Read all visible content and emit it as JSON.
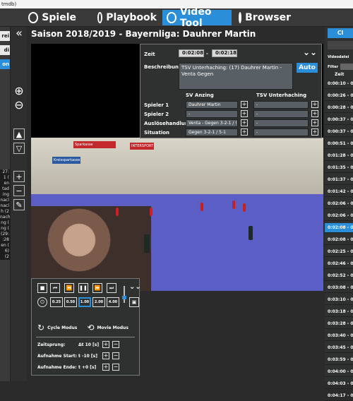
{
  "window_title": "tmdb)",
  "nav": {
    "tabs": [
      {
        "label": "Spiele",
        "icon": "soccer-ball-icon"
      },
      {
        "label": "Playbook",
        "icon": "playbook-icon"
      },
      {
        "label": "Video Tool",
        "icon": "play-icon"
      },
      {
        "label": "Browser",
        "icon": "globe-icon"
      }
    ]
  },
  "left_tabs": [
    "rei",
    "di",
    "on"
  ],
  "left_list": [
    "27:",
    "1 (",
    "en",
    "",
    "tad",
    "ing",
    "nacl",
    "nacl",
    "h (2",
    "nach",
    "ng (",
    "ng (",
    "(29:",
    "",
    ":28",
    "en (",
    "6)",
    "(2"
  ],
  "header": {
    "title": "Saison 2018/2019 - Bayernliga:  Dauhrer Martin"
  },
  "panel": {
    "zeit_label": "Zeit",
    "time_start": "0:02:08",
    "time_sep": "-",
    "time_end": "0:02:18",
    "beschreibung_label": "Beschreibung",
    "description": "TSV Unterhaching: (17) Dauhrer Martin - Venta Gegen",
    "auto_label": "Auto",
    "col_left": "SV Anzing",
    "col_right": "TSV Unterhaching",
    "rows": [
      {
        "label": "Spieler 1",
        "left": "Dauhrer Martin",
        "right": "-"
      },
      {
        "label": "Spieler 2",
        "left": "-",
        "right": "-"
      },
      {
        "label": "Auslösehandlung",
        "left": "Venta - Gegen 3-2-1 / !",
        "right": "-"
      },
      {
        "label": "Situation",
        "left": "Gegen 3-2-1 / 5-1",
        "right": "-"
      }
    ]
  },
  "controls": {
    "speeds": [
      "0.25",
      "0.50",
      "1.00",
      "2.00",
      "4.00"
    ],
    "selected_speed": "1.00",
    "cycle_label": "Cycle Modus",
    "movie_label": "Movie Modus",
    "zeitsprung_label": "Zeitsprung:",
    "zeitsprung_value": "Δt 10 [s]",
    "start_label": "Aufnahme Start:",
    "start_value": "t -10 [s]",
    "ende_label": "Aufnahme Ende:",
    "ende_value": "t +0 [s]"
  },
  "right_panel": {
    "top_button": "Cl",
    "videodatei_label": "Videodatei",
    "filter_label": "Filter",
    "zeit_header": "Zeit",
    "times": [
      "0:00:10 - 0",
      "0:00:26 - 0",
      "0:00:28 - 0",
      "0:00:37 - 0",
      "0:00:37 - 0",
      "0:00:51 - 0",
      "0:01:28 - 0",
      "0:01:35 - 0",
      "0:01:37 - 0",
      "0:01:42 - 0",
      "0:02:06 - 0",
      "0:02:06 - 0",
      "0:02:08 - 0",
      "0:02:08 - 0",
      "0:02:25 - 0",
      "0:02:46 - 0",
      "0:02:52 - 0",
      "0:03:08 - 0",
      "0:03:10 - 0",
      "0:03:18 - 0",
      "0:03:28 - 0",
      "0:03:40 - 0",
      "0:03:45 - 0",
      "0:03:59 - 0",
      "0:04:00 - 0",
      "0:04:03 - 0",
      "0:04:17 - 0"
    ],
    "selected_index": 12
  },
  "video": {
    "banners": [
      "Sparkasse",
      "INTERSPORT",
      "Kreissparkasse"
    ]
  }
}
